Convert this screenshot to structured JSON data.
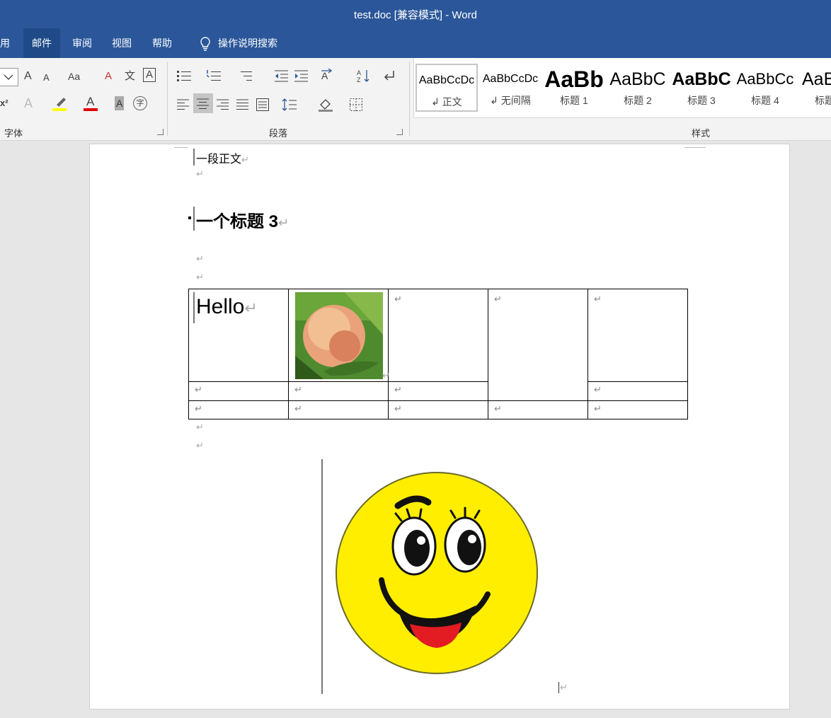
{
  "window": {
    "title": "test.doc [兼容模式]  -  Word"
  },
  "tabs": [
    {
      "label": "用"
    },
    {
      "label": "邮件"
    },
    {
      "label": "审阅"
    },
    {
      "label": "视图"
    },
    {
      "label": "帮助"
    },
    {
      "label": "操作说明搜索"
    }
  ],
  "ribbon": {
    "groups": {
      "font": "字体",
      "paragraph": "段落",
      "styles": "样式"
    },
    "font": {
      "grow": "A",
      "shrink": "A",
      "change_case": "Aa",
      "clear_fmt": "A",
      "phonetic": "文",
      "border_char": "A",
      "superscript": "x²",
      "text_effect": "A",
      "font_color": "A",
      "char_shade": "A",
      "enclose": "字"
    },
    "styles": [
      {
        "sample": "AaBbCcDc",
        "name": "↲ 正文"
      },
      {
        "sample": "AaBbCcDc",
        "name": "↲ 无间隔"
      },
      {
        "sample": "AaBb",
        "name": "标题 1"
      },
      {
        "sample": "AaBbC",
        "name": "标题 2"
      },
      {
        "sample": "AaBbC",
        "name": "标题 3"
      },
      {
        "sample": "AaBbCc",
        "name": "标题 4"
      },
      {
        "sample": "AaBl",
        "name": "标题"
      }
    ]
  },
  "document": {
    "line1": "一段正文",
    "heading": "一个标题 3",
    "cell_text": "Hello",
    "mark": "↵"
  },
  "colors": {
    "titlebar": "#2b579a",
    "active_tab": "#1f4a87",
    "highlight": "#ffff00",
    "font_color": "#e00000"
  }
}
